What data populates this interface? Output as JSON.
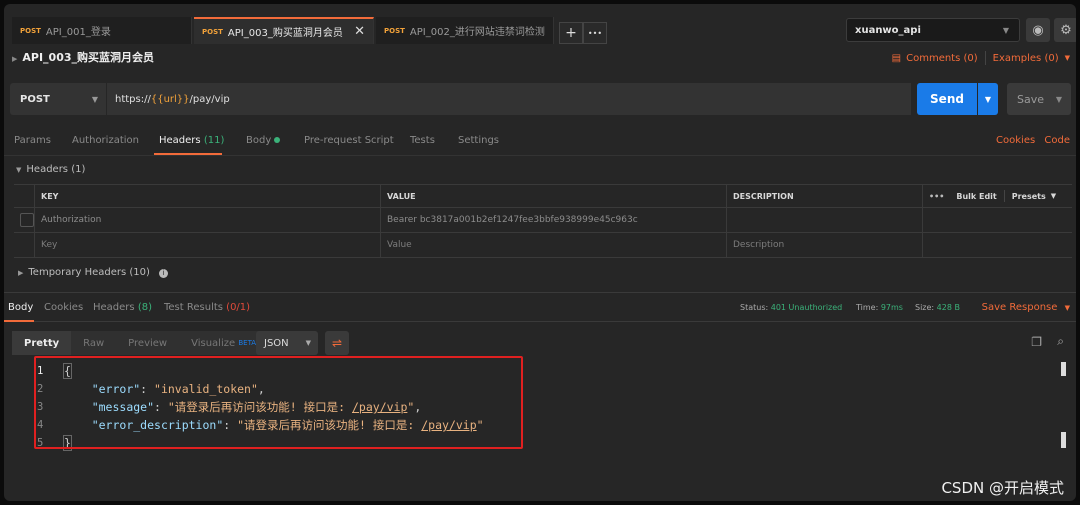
{
  "tabs": [
    {
      "method": "POST",
      "label": "API_001_登录"
    },
    {
      "method": "POST",
      "label": "API_003_购买蓝洞月会员"
    },
    {
      "method": "POST",
      "label": "API_002_进行网站违禁词检测"
    }
  ],
  "tab_close": "✕",
  "tab_add": "+",
  "tab_more": "•••",
  "environment": {
    "selected": "xuanwo_api"
  },
  "request": {
    "title": "API_003_购买蓝洞月会员",
    "comments_label": "Comments (0)",
    "examples_label": "Examples (0)",
    "method": "POST",
    "url_prefix": "https://",
    "url_var": "{{url}}",
    "url_suffix": "/pay/vip",
    "send_label": "Send",
    "save_label": "Save"
  },
  "request_tabs": {
    "params": "Params",
    "authorization": "Authorization",
    "headers": "Headers",
    "headers_count": "(11)",
    "body": "Body",
    "prerequest": "Pre-request Script",
    "tests": "Tests",
    "settings": "Settings",
    "cookies": "Cookies",
    "code": "Code"
  },
  "headers_section": {
    "title": "Headers (1)",
    "columns": {
      "key": "KEY",
      "value": "VALUE",
      "description": "DESCRIPTION"
    },
    "more": "•••",
    "bulk_edit": "Bulk Edit",
    "presets": "Presets",
    "rows": [
      {
        "key": "Authorization",
        "value": "Bearer bc3817a001b2ef1247fee3bbfe938999e45c963c",
        "description": ""
      }
    ],
    "placeholder": {
      "key": "Key",
      "value": "Value",
      "description": "Description"
    }
  },
  "temporary_headers": "Temporary Headers (10)",
  "response": {
    "tabs": {
      "body": "Body",
      "cookies": "Cookies",
      "headers": "Headers",
      "headers_count": "(8)",
      "tests": "Test Results",
      "tests_count": "(0/1)"
    },
    "status_label": "Status:",
    "status_value": "401 Unauthorized",
    "time_label": "Time:",
    "time_value": "97ms",
    "size_label": "Size:",
    "size_value": "428 B",
    "save_response": "Save Response",
    "view_tabs": {
      "pretty": "Pretty",
      "raw": "Raw",
      "preview": "Preview",
      "visualize": "Visualize",
      "beta": "BETA"
    },
    "format": "JSON",
    "lines": {
      "n1": "1",
      "n2": "2",
      "n3": "3",
      "n4": "4",
      "n5": "5",
      "open": "{",
      "close": "}",
      "error_key": "\"error\"",
      "error_val": "\"invalid_token\"",
      "message_key": "\"message\"",
      "message_val_pre": "\"请登录后再访问该功能! 接口是: ",
      "message_val_path": "/pay/vip",
      "message_val_post": "\"",
      "desc_key": "\"error_description\"",
      "desc_val_pre": "\"请登录后再访问该功能! 接口是: ",
      "desc_val_path": "/pay/vip",
      "desc_val_post": "\""
    }
  },
  "watermark": "CSDN @开启模式",
  "colors": {
    "accent": "#f26b3a",
    "send": "#1a7be8",
    "success": "#3bb27a",
    "error": "#e04a3a",
    "highlight_box": "#e02020"
  }
}
